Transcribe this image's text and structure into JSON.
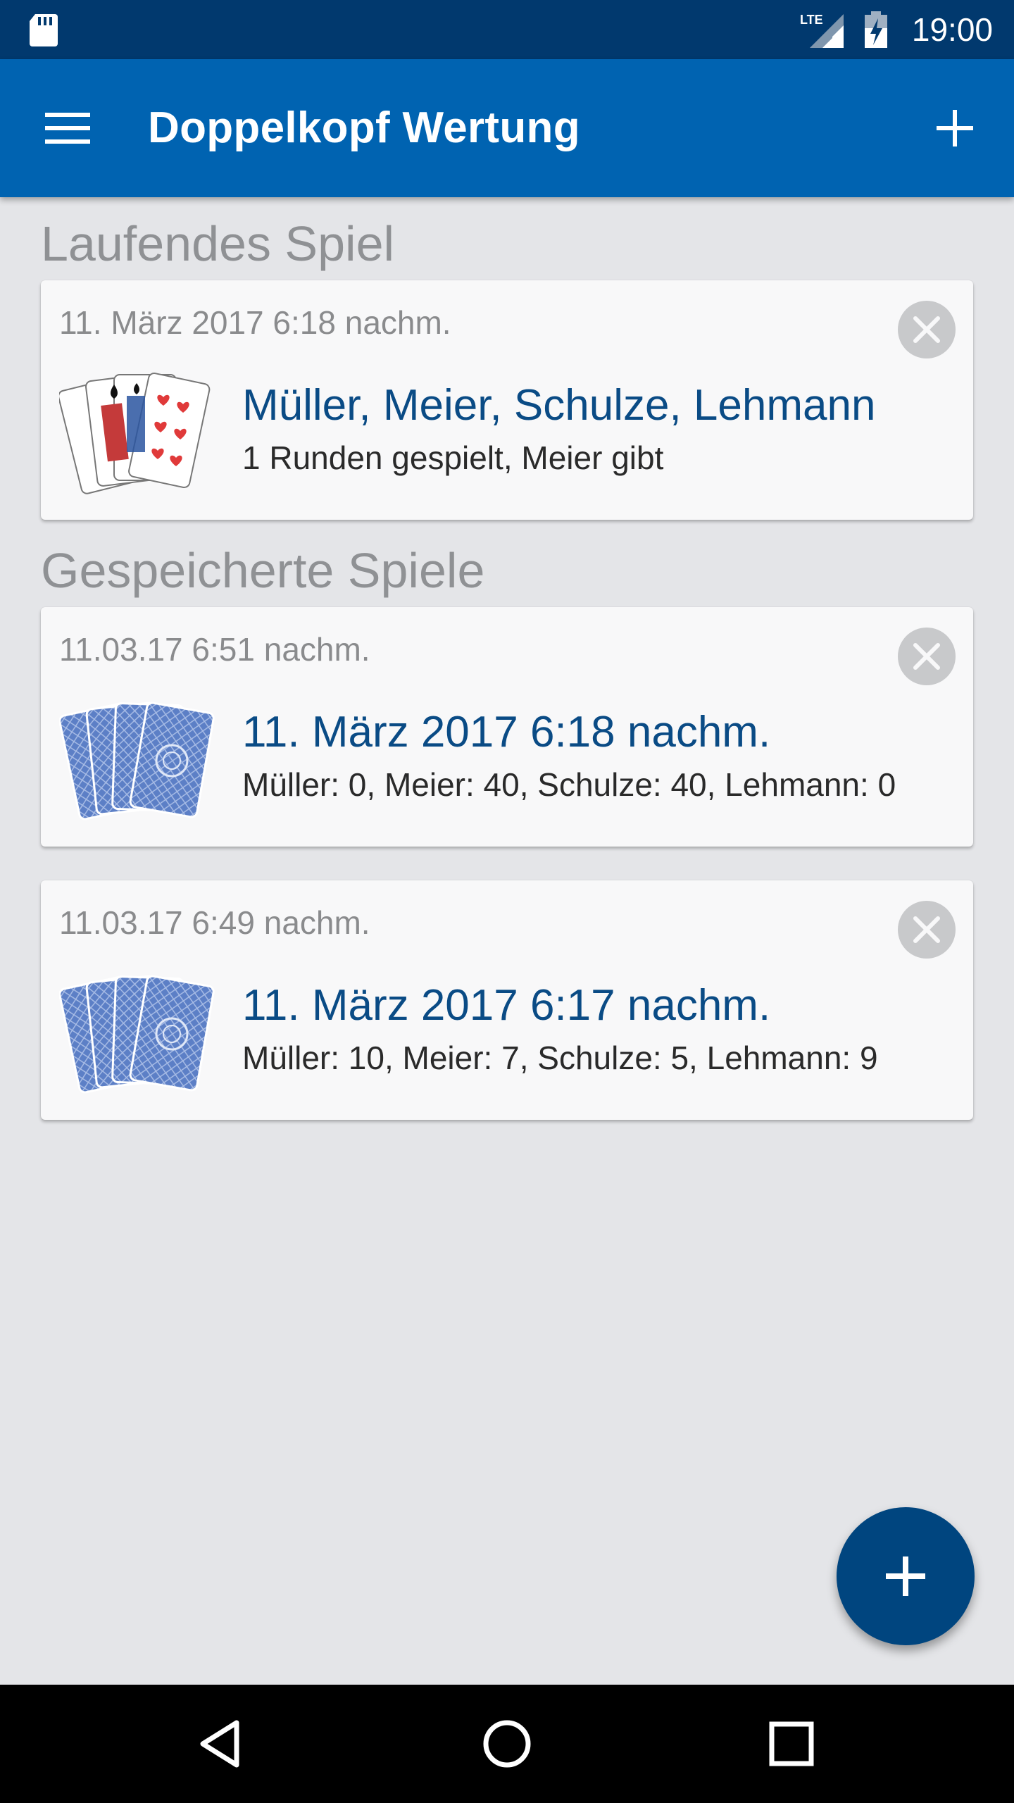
{
  "status_bar": {
    "time": "19:00",
    "icons": [
      "sd-card-icon",
      "lte-signal-icon",
      "battery-charging-icon"
    ],
    "signal_label": "LTE"
  },
  "app_bar": {
    "title": "Doppelkopf Wertung",
    "menu_icon": "hamburger-menu-icon",
    "add_icon": "plus-icon",
    "color": "#0063b1"
  },
  "running_section": {
    "heading": "Laufendes Spiel",
    "game": {
      "date": "11. März 2017 6:18 nachm.",
      "title": "Müller, Meier, Schulze, Lehmann",
      "subtitle": "1 Runden gespielt, Meier gibt",
      "thumbnail": "playing-cards-face-up-icon"
    }
  },
  "saved_section": {
    "heading": "Gespeicherte Spiele",
    "games": [
      {
        "date": "11.03.17 6:51 nachm.",
        "title": "11. März 2017 6:18 nachm.",
        "subtitle": "Müller: 0, Meier: 40, Schulze: 40, Lehmann: 0",
        "thumbnail": "playing-cards-back-icon"
      },
      {
        "date": "11.03.17 6:49 nachm.",
        "title": "11. März 2017 6:17 nachm.",
        "subtitle": "Müller: 10, Meier: 7, Schulze: 5, Lehmann: 9",
        "thumbnail": "playing-cards-back-icon"
      }
    ]
  },
  "fab": {
    "icon": "plus-icon",
    "color": "#00457f"
  },
  "nav_bar": {
    "buttons": [
      "back-icon",
      "home-icon",
      "recents-icon"
    ]
  },
  "colors": {
    "status_bar": "#01396e",
    "background": "#e4e5e8",
    "card_title": "#0a4b85",
    "section_heading": "#8f9194"
  }
}
